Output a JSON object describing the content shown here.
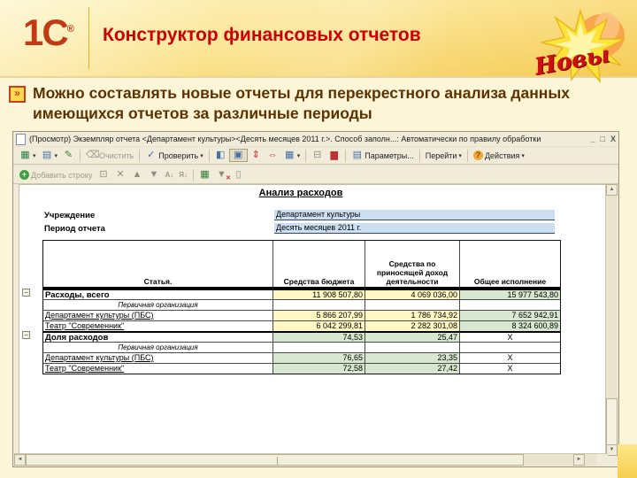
{
  "slide": {
    "logo_text": "1С",
    "logo_reg": "®",
    "title": "Конструктор финансовых отчетов",
    "badge_text": "Новы",
    "bullet_text": "Можно составлять новые отчеты для перекрестного анализа данных имеющихся отчетов за различные периоды"
  },
  "window": {
    "title": "(Просмотр) Экземпляр отчета <Департамент культуры><Десять месяцев 2011 г.>. Способ заполн...: Автоматически по правилу обработки",
    "minimize": "_",
    "maximize": "□",
    "close": "X"
  },
  "toolbar": {
    "clear": "Очистить",
    "check": "Проверить",
    "params": "Параметры...",
    "goto": "Перейти",
    "actions": "Действия",
    "add_row": "Добавить строку"
  },
  "icons": {
    "dropdown": "▾",
    "save": "▦",
    "export": "▤",
    "pen": "✎",
    "eraser": "⌫",
    "check": "✓",
    "panel_left": "◧",
    "panel_center": "▣",
    "rows_collapse": "⇕",
    "cols_collapse": "⇔",
    "table": "▦",
    "calc": "⊟",
    "chart": "▆",
    "params": "▤",
    "help": "?",
    "add": "+",
    "copy": "⊡",
    "delete": "✕",
    "up": "▲",
    "down": "▼",
    "sort_asc": "А↓",
    "sort_desc": "Я↓",
    "excel": "▦",
    "filter": "▼",
    "filter_x": "✕",
    "page": "▯",
    "minus": "−",
    "scroll_up": "▲",
    "scroll_down": "▼",
    "scroll_left": "◄",
    "scroll_right": "►"
  },
  "report": {
    "title": "Анализ расходов",
    "fields": [
      {
        "label": "Учреждение",
        "value": "Департамент культуры"
      },
      {
        "label": "Период отчета",
        "value": "Десять месяцев 2011 г."
      }
    ],
    "columns": {
      "c0": "Статья.",
      "c1": "Средства бюджета",
      "c2": "Средства по приносящей доход деятельности",
      "c3": "Общее исполнение"
    },
    "rows": [
      {
        "label": "Расходы, всего",
        "type": "section",
        "values": [
          "11 908 507,80",
          "4 069 036,00",
          "15 977 543,80"
        ]
      },
      {
        "label": "Первичная организация",
        "type": "subheader",
        "values": [
          "",
          "",
          ""
        ]
      },
      {
        "label": "Департамент культуры (ПБС)",
        "type": "item",
        "values": [
          "5 866 207,99",
          "1 786 734,92",
          "7 652 942,91"
        ]
      },
      {
        "label": "Театр \"Современник\"",
        "type": "item",
        "values": [
          "6 042 299,81",
          "2 282 301,08",
          "8 324 600,89"
        ]
      },
      {
        "label": "Доля расходов",
        "type": "section",
        "values": [
          "74,53",
          "25,47",
          "X"
        ]
      },
      {
        "label": "Первичная организация",
        "type": "subheader",
        "values": [
          "",
          "",
          ""
        ]
      },
      {
        "label": "Департамент культуры (ПБС)",
        "type": "item",
        "values": [
          "76,65",
          "23,35",
          "X"
        ]
      },
      {
        "label": "Театр \"Современник\"",
        "type": "item",
        "values": [
          "72,58",
          "27,42",
          "X"
        ]
      }
    ]
  },
  "colors": {
    "accent_red": "#CC0000",
    "logo_red": "#C03A14",
    "bullet_brown": "#5E3200",
    "cell_editable_yellow": "#FFF8C4",
    "cell_computed_green": "#D7E7D0",
    "field_blue": "#CBDFF1",
    "header_gold": "#F5CB55",
    "window_beige": "#F1ECDA"
  }
}
